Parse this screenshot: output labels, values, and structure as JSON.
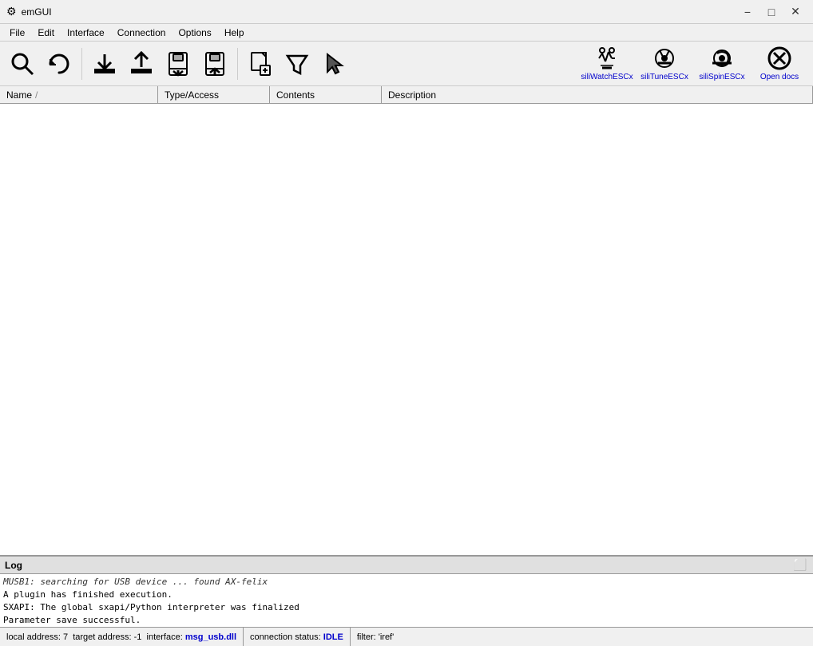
{
  "titlebar": {
    "icon": "⚙",
    "title": "emGUI",
    "minimize_label": "−",
    "maximize_label": "□",
    "close_label": "✕"
  },
  "menubar": {
    "items": [
      {
        "label": "File",
        "id": "file"
      },
      {
        "label": "Edit",
        "id": "edit"
      },
      {
        "label": "Interface",
        "id": "interface"
      },
      {
        "label": "Connection",
        "id": "connection"
      },
      {
        "label": "Options",
        "id": "options"
      },
      {
        "label": "Help",
        "id": "help"
      }
    ]
  },
  "toolbar": {
    "buttons": [
      {
        "id": "search",
        "icon": "search"
      },
      {
        "id": "refresh",
        "icon": "refresh"
      },
      {
        "id": "download",
        "icon": "download"
      },
      {
        "id": "upload",
        "icon": "upload"
      },
      {
        "id": "flash",
        "icon": "flash"
      },
      {
        "id": "upload2",
        "icon": "upload2"
      }
    ],
    "right_buttons": [
      {
        "id": "new",
        "icon": "new"
      },
      {
        "id": "filter",
        "icon": "filter"
      },
      {
        "id": "pointer",
        "icon": "pointer"
      }
    ],
    "plugins": [
      {
        "id": "siliWatchESCx",
        "label": "siliWatchESCx"
      },
      {
        "id": "siliTuneESCx",
        "label": "siliTuneESCx"
      },
      {
        "id": "siliSpinESCx",
        "label": "siliSpinESCx"
      },
      {
        "id": "openDocs",
        "label": "Open docs"
      }
    ]
  },
  "table": {
    "columns": [
      {
        "label": "Name",
        "id": "name",
        "sort_icon": "/"
      },
      {
        "label": "Type/Access",
        "id": "type"
      },
      {
        "label": "Contents",
        "id": "contents"
      },
      {
        "label": "Description",
        "id": "description"
      }
    ],
    "rows": []
  },
  "log": {
    "title": "Log",
    "lines": [
      {
        "text": "MUSB1: searching for USB device ... found AX-felix",
        "style": "italic"
      },
      {
        "text": "A plugin has finished execution.",
        "style": "normal"
      },
      {
        "text": "SXAPI: The global sxapi/Python interpreter was finalized",
        "style": "normal"
      },
      {
        "text": "Parameter save successful.",
        "style": "normal"
      }
    ]
  },
  "statusbar": {
    "local_address_label": "local address:",
    "local_address_value": "7",
    "target_address_label": "target address:",
    "target_address_value": "-1",
    "interface_label": "interface:",
    "interface_value": "msg_usb.dll",
    "connection_label": "connection status:",
    "connection_value": "IDLE",
    "filter_label": "filter:",
    "filter_value": "'iref'"
  }
}
